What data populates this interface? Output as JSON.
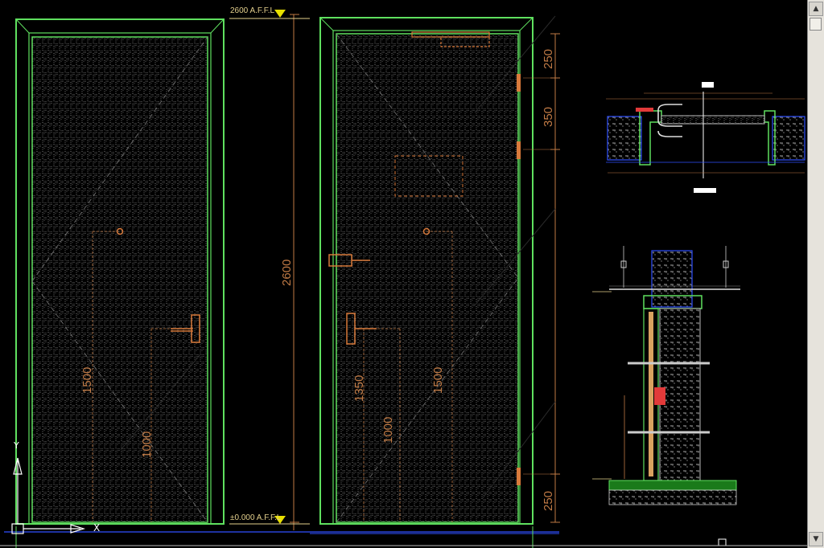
{
  "drawing": {
    "level_top": "2600 A.F.F.L",
    "level_bottom": "±0.000 A.F.F.L",
    "overall_height_dim": "2600",
    "right_dims": [
      "250",
      "350",
      "250"
    ],
    "left_door_dims": [
      "1500",
      "1000"
    ],
    "right_door_dims": [
      "1350",
      "1000",
      "1500"
    ],
    "detail_tag_1": "",
    "detail_tag_2": ""
  },
  "ucs_icon": {
    "y_label": "Y",
    "x_label": "X"
  },
  "scrollbar": {
    "up_arrow": "▲",
    "down_arrow": "▼"
  },
  "colors": {
    "background": "#000000",
    "frame_green": "#5fe05f",
    "grain_white": "#bfbfbf",
    "hardware_orange": "#d97a3b",
    "dim_orange": "#c07a45",
    "level_yellow": "#e8e000"
  }
}
